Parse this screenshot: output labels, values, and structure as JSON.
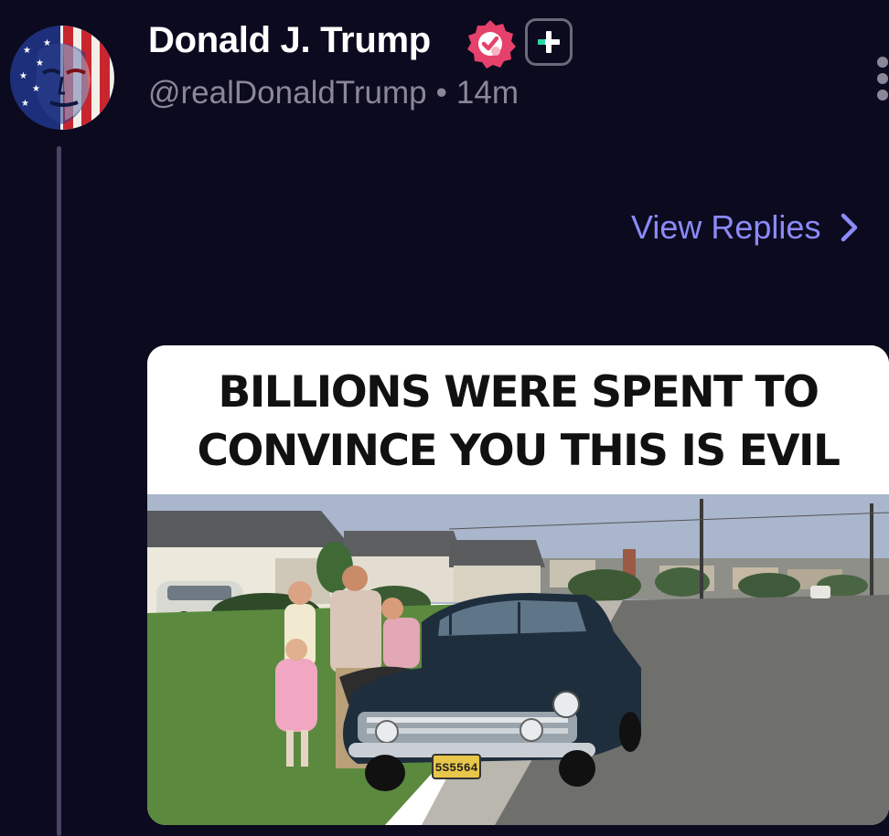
{
  "post": {
    "author": {
      "display_name": "Donald J. Trump",
      "handle": "@realDonaldTrump",
      "time_ago": "14m",
      "separator": "•"
    },
    "icons": {
      "verified": "verified-badge-icon",
      "plus": "plus-badge-icon",
      "more": "more-vertical-icon",
      "chevron": "chevron-right-icon"
    },
    "view_replies_label": "View Replies",
    "media": {
      "caption_line1": "BILLIONS WERE SPENT TO",
      "caption_line2": "CONVINCE YOU THIS IS EVIL",
      "license_plate": "5S5564"
    }
  },
  "colors": {
    "background": "#0c0a1f",
    "accent": "#8b8af7",
    "verified": "#e5416b",
    "muted_text": "#8a8799",
    "plus_accent": "#2bd4a4"
  }
}
